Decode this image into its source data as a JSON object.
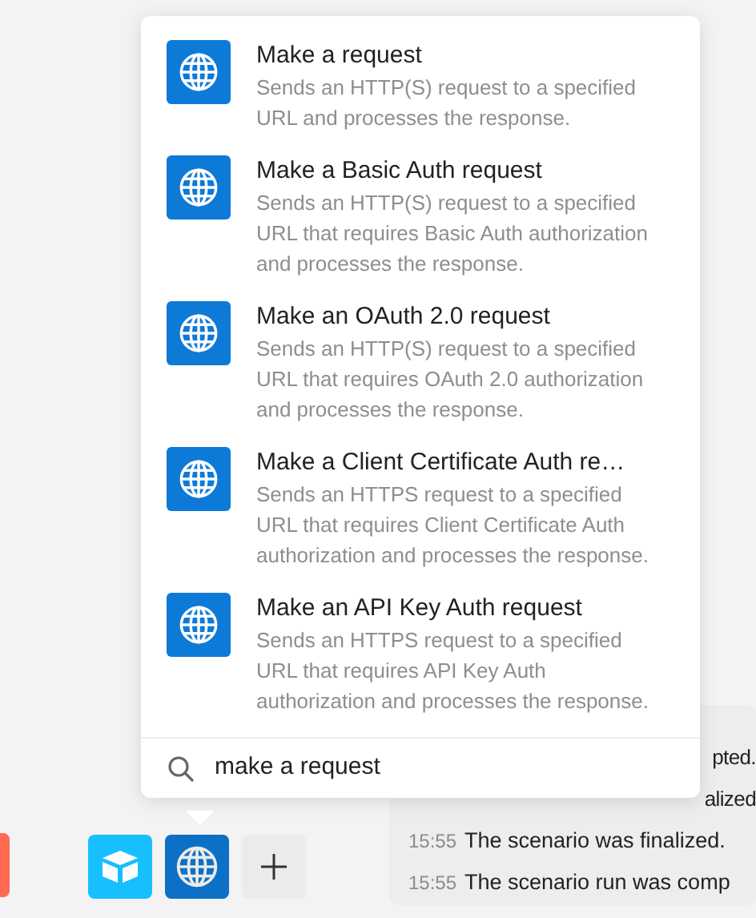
{
  "results": [
    {
      "title": "Make a request",
      "description": "Sends an HTTP(S) request to a specified URL and processes the response."
    },
    {
      "title": "Make a Basic Auth request",
      "description": "Sends an HTTP(S) request to a specified URL that requires Basic Auth authorization and processes the response."
    },
    {
      "title": "Make an OAuth 2.0 request",
      "description": "Sends an HTTP(S) request to a specified URL that requires OAuth 2.0 authorization and processes the response."
    },
    {
      "title": "Make a Client Certificate Auth re…",
      "description": "Sends an HTTPS request to a specified URL that requires Client Certificate Auth authorization and processes the response."
    },
    {
      "title": "Make an API Key Auth request",
      "description": "Sends an HTTPS request to a specified URL that requires API Key Auth authorization and processes the response."
    }
  ],
  "search": {
    "value": "make a request"
  },
  "favorites": [
    {
      "kind": "box",
      "selected": false
    },
    {
      "kind": "globe",
      "selected": true
    },
    {
      "kind": "add",
      "selected": false
    }
  ],
  "log": [
    {
      "message": "pted."
    },
    {
      "message": "alized"
    },
    {
      "time": "15:55",
      "message": "The scenario was finalized."
    },
    {
      "time": "15:55",
      "message": "The scenario run was comp"
    }
  ]
}
